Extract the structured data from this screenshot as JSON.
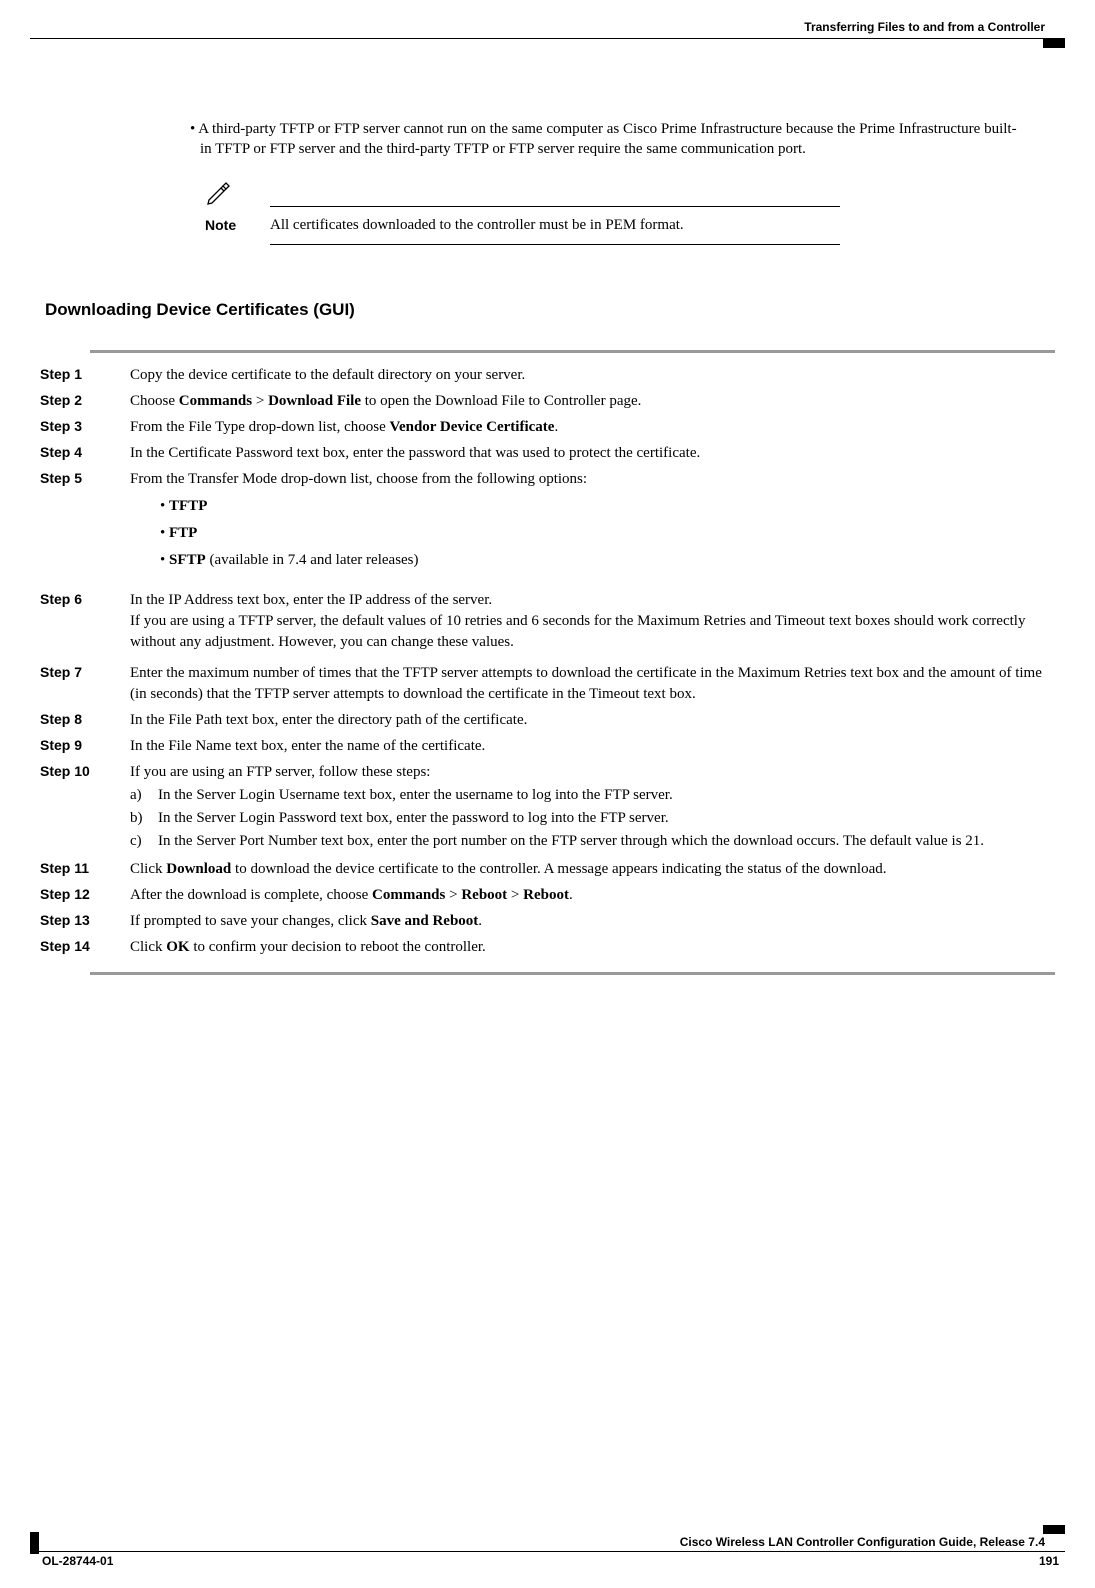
{
  "header": {
    "chapter": "Transferring Files to and from a Controller"
  },
  "intro": {
    "bullet_prefix": "• ",
    "bullet": "A third-party TFTP or FTP server cannot run on the same computer as Cisco Prime Infrastructure because the Prime Infrastructure built-in TFTP or FTP server and the third-party TFTP or FTP server require the same communication port."
  },
  "note": {
    "label": "Note",
    "text": "All certificates downloaded to the controller must be in PEM format."
  },
  "section": {
    "heading": "Downloading Device Certificates (GUI)"
  },
  "steps": {
    "s1": {
      "label": "Step 1",
      "t1": "Copy the device certificate to the default directory on your server."
    },
    "s2": {
      "label": "Step 2",
      "pre": "Choose ",
      "b1": "Commands",
      "mid1": " > ",
      "b2": "Download File",
      "post": " to open the Download File to Controller page."
    },
    "s3": {
      "label": "Step 3",
      "pre": "From the File Type drop-down list, choose ",
      "b1": "Vendor Device Certificate",
      "post": "."
    },
    "s4": {
      "label": "Step 4",
      "t1": "In the Certificate Password text box, enter the password that was used to protect the certificate."
    },
    "s5": {
      "label": "Step 5",
      "t1": "From the Transfer Mode drop-down list, choose from the following options:",
      "opt1": "TFTP",
      "opt2": "FTP",
      "opt3": "SFTP",
      "opt3_post": " (available in 7.4 and later releases)"
    },
    "s6": {
      "label": "Step 6",
      "l1": "In the IP Address text box, enter the IP address of the server.",
      "l2": "If you are using a TFTP server, the default values of 10 retries and 6 seconds for the Maximum Retries and Timeout text boxes should work correctly without any adjustment. However, you can change these values."
    },
    "s7": {
      "label": "Step 7",
      "t1": "Enter the maximum number of times that the TFTP server attempts to download the certificate in the Maximum Retries text box and the amount of time (in seconds) that the TFTP server attempts to download the certificate in the Timeout text box."
    },
    "s8": {
      "label": "Step 8",
      "t1": "In the File Path text box, enter the directory path of the certificate."
    },
    "s9": {
      "label": "Step 9",
      "t1": "In the File Name text box, enter the name of the certificate."
    },
    "s10": {
      "label": "Step 10",
      "t1": "If you are using an FTP server, follow these steps:",
      "a": "In the Server Login Username text box, enter the username to log into the FTP server.",
      "b": "In the Server Login Password text box, enter the password to log into the FTP server.",
      "c": "In the Server Port Number text box, enter the port number on the FTP server through which the download occurs. The default value is 21."
    },
    "s11": {
      "label": "Step 11",
      "pre": "Click ",
      "b1": "Download",
      "post": " to download the device certificate to the controller. A message appears indicating the status of the download."
    },
    "s12": {
      "label": "Step 12",
      "pre": "After the download is complete, choose ",
      "b1": "Commands",
      "mid1": " > ",
      "b2": "Reboot",
      "mid2": " > ",
      "b3": "Reboot",
      "post": "."
    },
    "s13": {
      "label": "Step 13",
      "pre": "If prompted to save your changes, click ",
      "b1": "Save and Reboot",
      "post": "."
    },
    "s14": {
      "label": "Step 14",
      "pre": "Click ",
      "b1": "OK",
      "post": " to confirm your decision to reboot the controller."
    }
  },
  "sub_labels": {
    "a": "a)",
    "b": "b)",
    "c": "c)"
  },
  "footer": {
    "title": "Cisco Wireless LAN Controller Configuration Guide, Release 7.4",
    "doc_id": "OL-28744-01",
    "page": "191"
  }
}
